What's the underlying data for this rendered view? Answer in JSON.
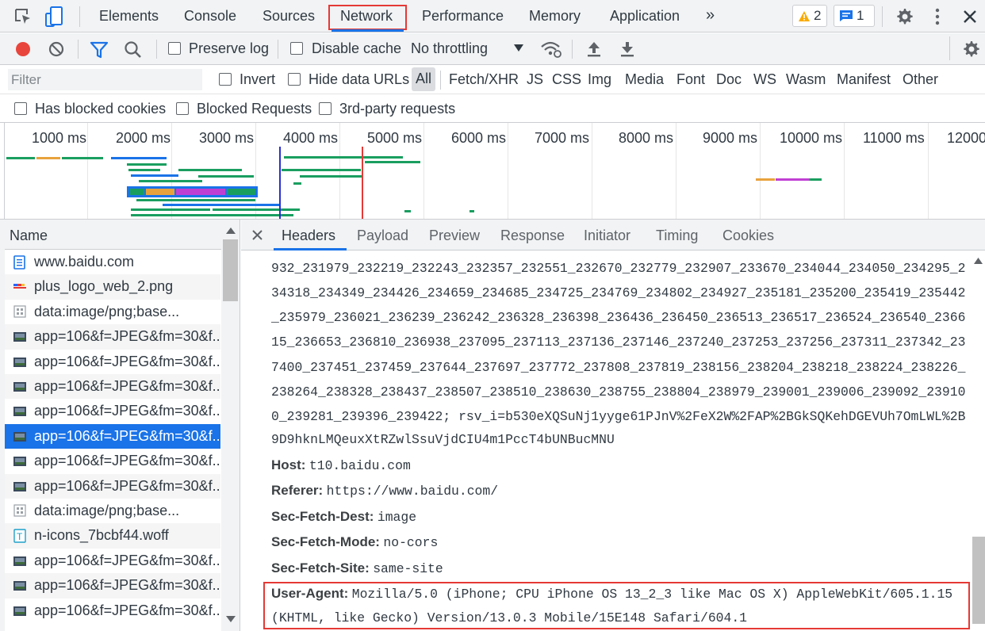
{
  "top_tabs": [
    "Elements",
    "Console",
    "Sources",
    "Network",
    "Performance",
    "Memory",
    "Application"
  ],
  "more_tabs": "»",
  "warnings_count": "2",
  "messages_count": "1",
  "toolbar": {
    "preserve_log": "Preserve log",
    "disable_cache": "Disable cache",
    "throttling": "No throttling"
  },
  "filter": {
    "placeholder": "Filter",
    "invert": "Invert",
    "hide_data_urls": "Hide data URLs",
    "types": [
      "All",
      "Fetch/XHR",
      "JS",
      "CSS",
      "Img",
      "Media",
      "Font",
      "Doc",
      "WS",
      "Wasm",
      "Manifest",
      "Other"
    ]
  },
  "blocked": {
    "has_blocked_cookies": "Has blocked cookies",
    "blocked_requests": "Blocked Requests",
    "third_party": "3rd-party requests"
  },
  "overview_ticks": [
    "1000 ms",
    "2000 ms",
    "3000 ms",
    "4000 ms",
    "5000 ms",
    "6000 ms",
    "7000 ms",
    "8000 ms",
    "9000 ms",
    "10000 ms",
    "11000 ms",
    "12000"
  ],
  "request_list": {
    "header": "Name",
    "rows": [
      {
        "name": "www.baidu.com",
        "icon": "document-icon"
      },
      {
        "name": "plus_logo_web_2.png",
        "icon": "image-icon"
      },
      {
        "name": "data:image/png;base...",
        "icon": "data-image-icon"
      },
      {
        "name": "app=106&f=JPEG&fm=30&f...",
        "icon": "image-thumbnail-icon"
      },
      {
        "name": "app=106&f=JPEG&fm=30&f...",
        "icon": "image-thumbnail-icon"
      },
      {
        "name": "app=106&f=JPEG&fm=30&f...",
        "icon": "image-thumbnail-icon"
      },
      {
        "name": "app=106&f=JPEG&fm=30&f...",
        "icon": "image-thumbnail-icon"
      },
      {
        "name": "app=106&f=JPEG&fm=30&f...",
        "icon": "image-thumbnail-icon",
        "selected": true
      },
      {
        "name": "app=106&f=JPEG&fm=30&f...",
        "icon": "image-thumbnail-icon"
      },
      {
        "name": "app=106&f=JPEG&fm=30&f...",
        "icon": "image-thumbnail-icon"
      },
      {
        "name": "data:image/png;base...",
        "icon": "data-image-icon"
      },
      {
        "name": "n-icons_7bcbf44.woff",
        "icon": "font-icon"
      },
      {
        "name": "app=106&f=JPEG&fm=30&f...",
        "icon": "image-thumbnail-icon"
      },
      {
        "name": "app=106&f=JPEG&fm=30&f...",
        "icon": "image-thumbnail-icon"
      },
      {
        "name": "app=106&f=JPEG&fm=30&f...",
        "icon": "image-thumbnail-icon"
      }
    ]
  },
  "detail_tabs": [
    "Headers",
    "Payload",
    "Preview",
    "Response",
    "Initiator",
    "Timing",
    "Cookies"
  ],
  "headers": {
    "cookie_continuation": [
      "932_231979_232219_232243_232357_232551_232670_232779_232907_233670_234044_234050_234295_2",
      "34318_234349_234426_234659_234685_234725_234769_234802_234927_235181_235200_235419_235442",
      "_235979_236021_236239_236242_236328_236398_236436_236450_236513_236517_236524_236540_2366",
      "15_236653_236810_236938_237095_237113_237136_237146_237240_237253_237256_237311_237342_23",
      "7400_237451_237459_237644_237697_237772_237808_237819_238156_238204_238218_238224_238226_",
      "238264_238328_238437_238507_238510_238630_238755_238804_238979_239001_239006_239092_23910",
      "0_239281_239396_239422; rsv_i=b530eXQSuNj1yyge61PJnV%2FeX2W%2FAP%2BGkSQKehDGEVUh7OmLWL%2B",
      "9D9hknLMQeuxXtRZwlSsuVjdCIU4m1PccT4bUNBucMNU"
    ],
    "items": [
      {
        "key": "Host:",
        "value": "t10.baidu.com"
      },
      {
        "key": "Referer:",
        "value": "https://www.baidu.com/"
      },
      {
        "key": "Sec-Fetch-Dest:",
        "value": "image"
      },
      {
        "key": "Sec-Fetch-Mode:",
        "value": "no-cors"
      },
      {
        "key": "Sec-Fetch-Site:",
        "value": "same-site"
      }
    ],
    "user_agent": {
      "key": "User-Agent:",
      "value_line1": "Mozilla/5.0 (iPhone; CPU iPhone OS 13_2_3 like Mac OS X) AppleWebKit/605.1.15",
      "value_line2": "(KHTML, like Gecko) Version/13.0.3 Mobile/15E148 Safari/604.1"
    }
  },
  "colors": {
    "accent": "#1a73e8",
    "highlight_box": "#e53935",
    "record": "#e8453c"
  }
}
